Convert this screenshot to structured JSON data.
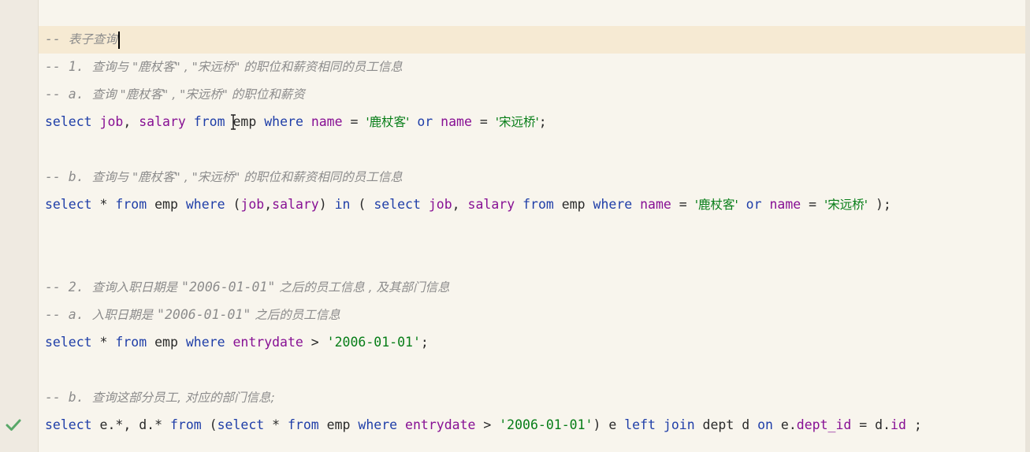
{
  "editor": {
    "lines": [
      {
        "segments": [
          {
            "t": "-- ",
            "c": "c"
          },
          {
            "t": "表子查询",
            "c": "cz"
          }
        ]
      },
      {
        "segments": [
          {
            "t": "-- 1. ",
            "c": "c"
          },
          {
            "t": "查询与 \"鹿杖客\" , \"宋远桥\" 的职位和薪资相同的员工信息",
            "c": "cz"
          }
        ]
      },
      {
        "segments": [
          {
            "t": "-- a. ",
            "c": "c"
          },
          {
            "t": "查询 \"鹿杖客\" , \"宋远桥\" 的职位和薪资",
            "c": "cz"
          }
        ]
      },
      {
        "segments": [
          {
            "t": "select ",
            "c": "kw"
          },
          {
            "t": "job",
            "c": "id"
          },
          {
            "t": ", ",
            "c": "pl"
          },
          {
            "t": "salary",
            "c": "id"
          },
          {
            "t": " ",
            "c": "pl"
          },
          {
            "t": "from",
            "c": "kw"
          },
          {
            "t": " emp ",
            "c": "pl"
          },
          {
            "t": "where",
            "c": "kw"
          },
          {
            "t": " ",
            "c": "pl"
          },
          {
            "t": "name",
            "c": "id"
          },
          {
            "t": " = ",
            "c": "pl"
          },
          {
            "t": "'鹿杖客'",
            "c": "strz"
          },
          {
            "t": " ",
            "c": "pl"
          },
          {
            "t": "or",
            "c": "kw"
          },
          {
            "t": " ",
            "c": "pl"
          },
          {
            "t": "name",
            "c": "id"
          },
          {
            "t": " = ",
            "c": "pl"
          },
          {
            "t": "'宋远桥'",
            "c": "strz"
          },
          {
            "t": ";",
            "c": "pl"
          }
        ]
      },
      {
        "segments": []
      },
      {
        "segments": [
          {
            "t": "-- b. ",
            "c": "c"
          },
          {
            "t": "查询与 \"鹿杖客\" , \"宋远桥\" 的职位和薪资相同的员工信息",
            "c": "cz"
          }
        ]
      },
      {
        "segments": [
          {
            "t": "select",
            "c": "kw"
          },
          {
            "t": " * ",
            "c": "pl"
          },
          {
            "t": "from",
            "c": "kw"
          },
          {
            "t": " emp ",
            "c": "pl"
          },
          {
            "t": "where",
            "c": "kw"
          },
          {
            "t": " (",
            "c": "pl"
          },
          {
            "t": "job",
            "c": "id"
          },
          {
            "t": ",",
            "c": "pl"
          },
          {
            "t": "salary",
            "c": "id"
          },
          {
            "t": ") ",
            "c": "pl"
          },
          {
            "t": "in",
            "c": "kw"
          },
          {
            "t": " ( ",
            "c": "pl"
          },
          {
            "t": "select",
            "c": "kw"
          },
          {
            "t": " ",
            "c": "pl"
          },
          {
            "t": "job",
            "c": "id"
          },
          {
            "t": ", ",
            "c": "pl"
          },
          {
            "t": "salary",
            "c": "id"
          },
          {
            "t": " ",
            "c": "pl"
          },
          {
            "t": "from",
            "c": "kw"
          },
          {
            "t": " emp ",
            "c": "pl"
          },
          {
            "t": "where",
            "c": "kw"
          },
          {
            "t": " ",
            "c": "pl"
          },
          {
            "t": "name",
            "c": "id"
          },
          {
            "t": " = ",
            "c": "pl"
          },
          {
            "t": "'鹿杖客'",
            "c": "strz"
          },
          {
            "t": " ",
            "c": "pl"
          },
          {
            "t": "or",
            "c": "kw"
          },
          {
            "t": " ",
            "c": "pl"
          },
          {
            "t": "name",
            "c": "id"
          },
          {
            "t": " = ",
            "c": "pl"
          },
          {
            "t": "'宋远桥'",
            "c": "strz"
          },
          {
            "t": " );",
            "c": "pl"
          }
        ]
      },
      {
        "segments": []
      },
      {
        "segments": []
      },
      {
        "segments": [
          {
            "t": "-- 2. ",
            "c": "c"
          },
          {
            "t": "查询入职日期是 ",
            "c": "cz"
          },
          {
            "t": "\"2006-01-01\"",
            "c": "c"
          },
          {
            "t": " 之后的员工信息 , 及其部门信息",
            "c": "cz"
          }
        ]
      },
      {
        "segments": [
          {
            "t": "-- a. ",
            "c": "c"
          },
          {
            "t": "入职日期是 ",
            "c": "cz"
          },
          {
            "t": "\"2006-01-01\"",
            "c": "c"
          },
          {
            "t": " 之后的员工信息",
            "c": "cz"
          }
        ]
      },
      {
        "segments": [
          {
            "t": "select",
            "c": "kw"
          },
          {
            "t": " * ",
            "c": "pl"
          },
          {
            "t": "from",
            "c": "kw"
          },
          {
            "t": " emp ",
            "c": "pl"
          },
          {
            "t": "where",
            "c": "kw"
          },
          {
            "t": " ",
            "c": "pl"
          },
          {
            "t": "entrydate",
            "c": "id"
          },
          {
            "t": " > ",
            "c": "pl"
          },
          {
            "t": "'2006-01-01'",
            "c": "str"
          },
          {
            "t": ";",
            "c": "pl"
          }
        ]
      },
      {
        "segments": []
      },
      {
        "segments": [
          {
            "t": "-- b. ",
            "c": "c"
          },
          {
            "t": "查询这部分员工, 对应的部门信息;",
            "c": "cz"
          }
        ]
      },
      {
        "segments": [
          {
            "t": "select",
            "c": "kw"
          },
          {
            "t": " e.*, d.* ",
            "c": "pl"
          },
          {
            "t": "from",
            "c": "kw"
          },
          {
            "t": " (",
            "c": "pl"
          },
          {
            "t": "select",
            "c": "kw"
          },
          {
            "t": " * ",
            "c": "pl"
          },
          {
            "t": "from",
            "c": "kw"
          },
          {
            "t": " emp ",
            "c": "pl"
          },
          {
            "t": "where",
            "c": "kw"
          },
          {
            "t": " ",
            "c": "pl"
          },
          {
            "t": "entrydate",
            "c": "id"
          },
          {
            "t": " > ",
            "c": "pl"
          },
          {
            "t": "'2006-01-01'",
            "c": "str"
          },
          {
            "t": ") e ",
            "c": "pl"
          },
          {
            "t": "left join",
            "c": "kw"
          },
          {
            "t": " dept d ",
            "c": "pl"
          },
          {
            "t": "on",
            "c": "kw"
          },
          {
            "t": " e.",
            "c": "pl"
          },
          {
            "t": "dept_id",
            "c": "id"
          },
          {
            "t": " = d.",
            "c": "pl"
          },
          {
            "t": "id",
            "c": "id"
          },
          {
            "t": " ;",
            "c": "pl"
          }
        ]
      }
    ],
    "current_line": 0,
    "gutter_markers": [
      {
        "line": 14,
        "icon": "checkmark-icon",
        "color": "#59a869"
      }
    ]
  },
  "colors": {
    "background": "#f8f5ed",
    "current_line": "#f6ead3",
    "keyword": "#1f3ea8",
    "identifier": "#871094",
    "string": "#067d17",
    "comment": "#8c8c8c"
  }
}
